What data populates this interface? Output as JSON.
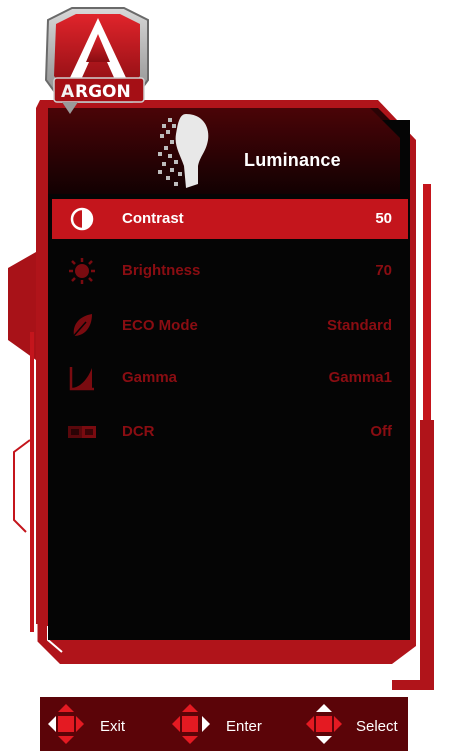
{
  "brand": {
    "logo_text": "RGON"
  },
  "menu": {
    "title": "Luminance",
    "items": [
      {
        "label": "Contrast",
        "value": "50",
        "icon": "contrast-icon",
        "selected": true
      },
      {
        "label": "Brightness",
        "value": "70",
        "icon": "brightness-icon",
        "selected": false
      },
      {
        "label": "ECO Mode",
        "value": "Standard",
        "icon": "leaf-icon",
        "selected": false
      },
      {
        "label": "Gamma",
        "value": "Gamma1",
        "icon": "gamma-curve-icon",
        "selected": false
      },
      {
        "label": "DCR",
        "value": "Off",
        "icon": "dcr-icon",
        "selected": false
      }
    ]
  },
  "keys": {
    "exit": {
      "label": "Exit"
    },
    "enter": {
      "label": "Enter"
    },
    "select": {
      "label": "Select"
    }
  },
  "colors": {
    "accent": "#c4151c",
    "dim_text": "#8a0d12",
    "panel": "#050505",
    "keybar": "#5b0408"
  }
}
